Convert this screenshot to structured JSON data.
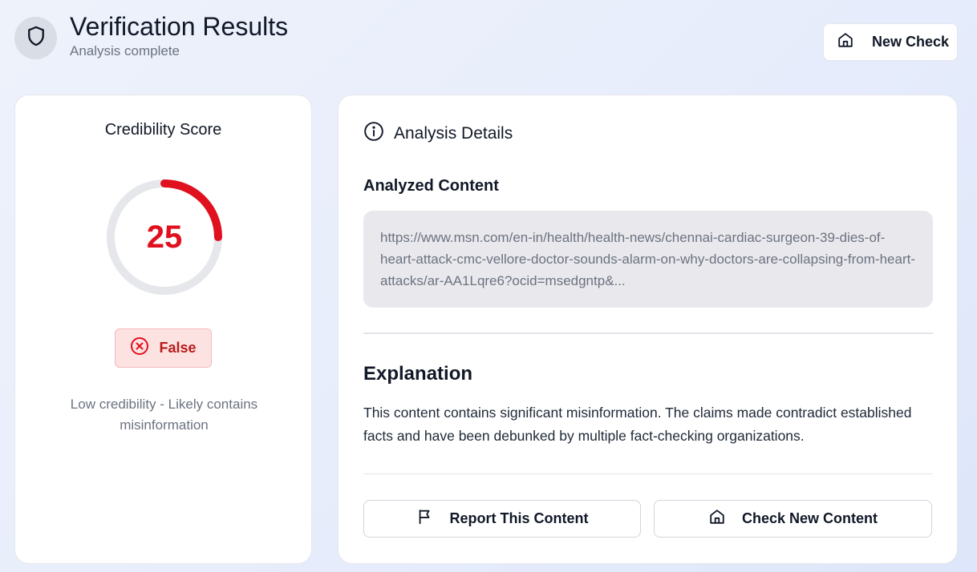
{
  "header": {
    "title": "Verification Results",
    "subtitle": "Analysis complete",
    "new_check_label": "New Check"
  },
  "score": {
    "title": "Credibility Score",
    "value": 25,
    "value_label": "25",
    "max": 100,
    "verdict": "False",
    "description": "Low credibility - Likely contains misinformation"
  },
  "details": {
    "heading": "Analysis Details",
    "analyzed_title": "Analyzed Content",
    "analyzed_content": "https://www.msn.com/en-in/health/health-news/chennai-cardiac-surgeon-39-dies-of-heart-attack-cmc-vellore-doctor-sounds-alarm-on-why-doctors-are-collapsing-from-heart-attacks/ar-AA1Lqre6?ocid=msedgntp&...",
    "explanation_title": "Explanation",
    "explanation": "This content contains significant misinformation. The claims made contradict established facts and have been debunked by multiple fact-checking organizations.",
    "report_label": "Report This Content",
    "check_new_label": "Check New Content"
  },
  "icons": {
    "logo": "shield-icon",
    "home": "home-icon",
    "info": "info-icon",
    "verdict": "x-circle-icon",
    "report": "flag-icon"
  },
  "colors": {
    "danger": "#e0101e",
    "verdict_text": "#b91c1c",
    "gauge_track": "#e5e7eb"
  }
}
